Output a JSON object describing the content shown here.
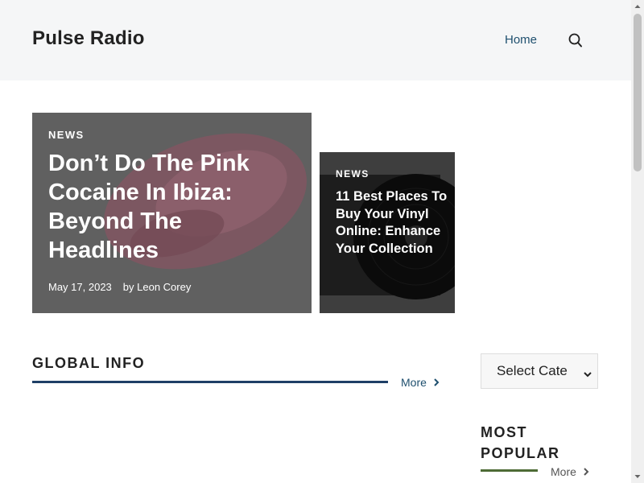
{
  "header": {
    "site_title": "Pulse Radio",
    "nav": [
      {
        "label": "Home"
      }
    ],
    "search_icon": "search-icon"
  },
  "featured": [
    {
      "category": "NEWS",
      "title": "Don’t Do The Pink Cocaine In Ibiza: Beyond The Headlines",
      "date": "May 17, 2023",
      "author": "by Leon Corey"
    },
    {
      "category": "NEWS",
      "title": "11 Best Places To Buy Your Vinyl Online: Enhance Your Collection"
    }
  ],
  "section": {
    "title": "GLOBAL INFO",
    "more_label": "More"
  },
  "sidebar": {
    "select_label": "Select Cate",
    "popular_title": "MOST POPULAR",
    "more_label": "More"
  },
  "colors": {
    "header_bg": "#f5f6f7",
    "link": "#1e4f6e",
    "section_line": "#1e3f66",
    "popular_line": "#4d6b35"
  }
}
